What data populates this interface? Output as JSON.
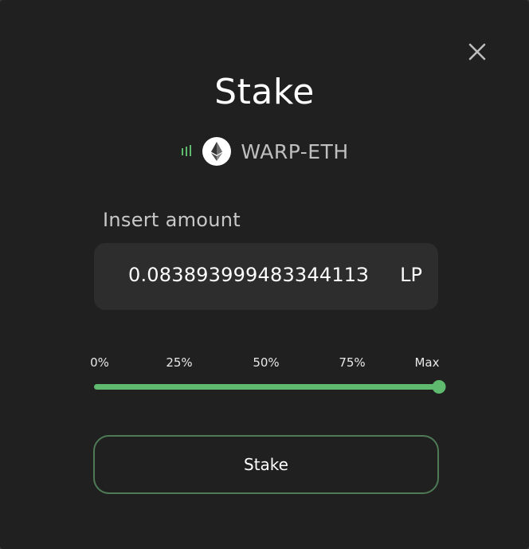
{
  "modal": {
    "title": "Stake",
    "close_icon": "close-icon"
  },
  "pair": {
    "name": "WARP-ETH",
    "icons": [
      "warp-icon",
      "eth-icon"
    ]
  },
  "amount": {
    "label": "Insert amount",
    "value": "0.08389399948334411З",
    "unit": "LP"
  },
  "slider": {
    "labels": [
      "0%",
      "25%",
      "50%",
      "75%",
      "Max"
    ],
    "value_fraction": 1.0
  },
  "stake_button": {
    "label": "Stake"
  },
  "colors": {
    "background": "#202020",
    "input_background": "#2d2d2d",
    "accent": "#5fb96e",
    "button_border": "#4e7a55"
  }
}
